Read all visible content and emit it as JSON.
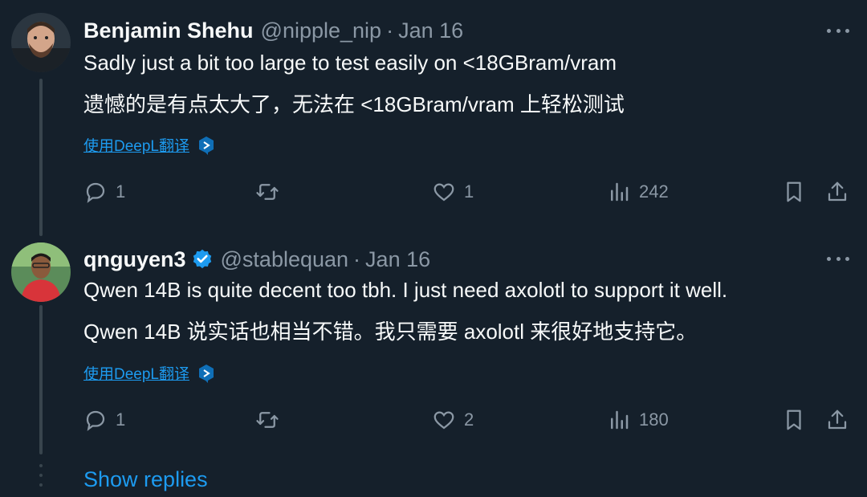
{
  "tweets": [
    {
      "name": "Benjamin Shehu",
      "verified": false,
      "handle": "@nipple_nip",
      "separator": "·",
      "date": "Jan 16",
      "text_en": "Sadly just a bit too large to test easily on <18GBram/vram",
      "text_zh": "遗憾的是有点太大了，无法在 <18GBram/vram 上轻松测试",
      "translate_label": "使用DeepL翻译",
      "replies": "1",
      "retweets": "",
      "likes": "1",
      "views": "242"
    },
    {
      "name": "qnguyen3",
      "verified": true,
      "handle": "@stablequan",
      "separator": "·",
      "date": "Jan 16",
      "text_en": "Qwen 14B is quite decent too tbh. I just need axolotl to support it well.",
      "text_zh": "Qwen 14B 说实话也相当不错。我只需要 axolotl 来很好地支持它。",
      "translate_label": "使用DeepL翻译",
      "replies": "1",
      "retweets": "",
      "likes": "2",
      "views": "180"
    }
  ],
  "show_replies_label": "Show replies",
  "colors": {
    "background": "#15202b",
    "text": "#f7f9f9",
    "muted": "#8b98a5",
    "accent": "#1d9bf0",
    "thread_line": "#38444d"
  },
  "icons": [
    "more-icon",
    "verified-badge-icon",
    "deepl-icon",
    "reply-icon",
    "retweet-icon",
    "like-icon",
    "views-icon",
    "bookmark-icon",
    "share-icon"
  ]
}
